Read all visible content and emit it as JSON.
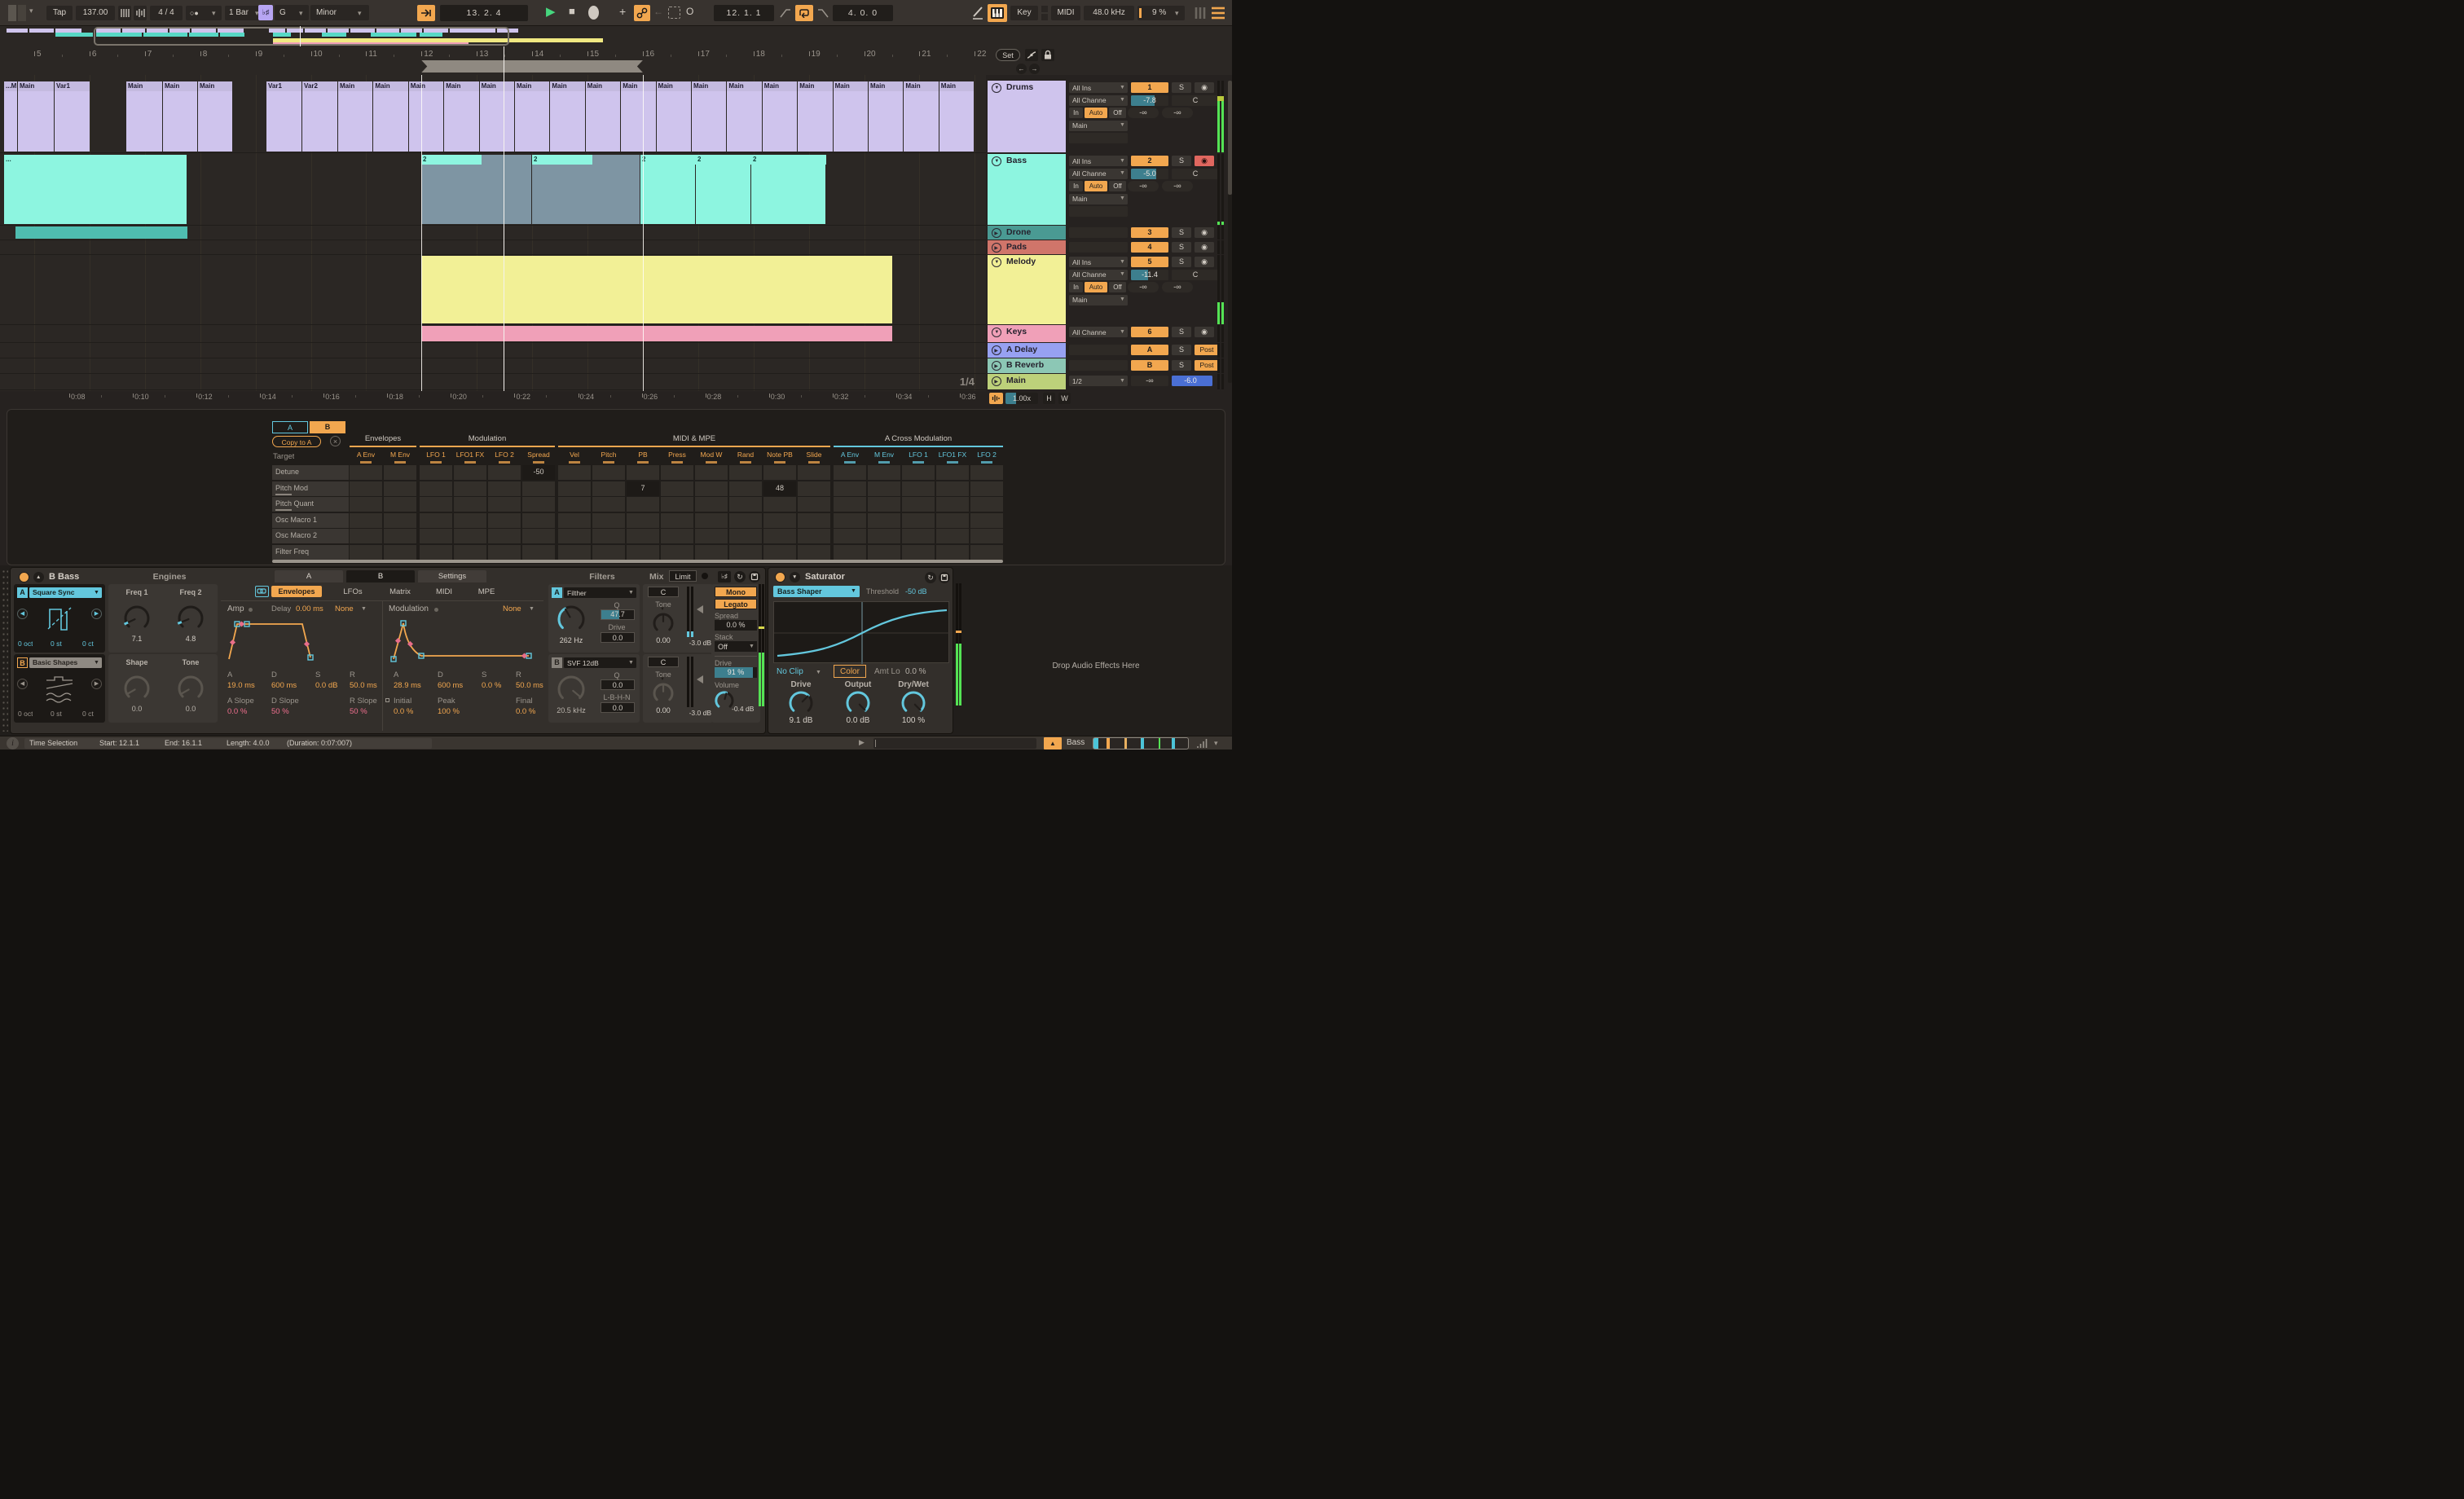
{
  "transport": {
    "tap": "Tap",
    "tempo": "137.00",
    "time_sig": "4 / 4",
    "quantize": "1 Bar",
    "scale_icon": "♭♯",
    "root": "G",
    "mode": "Minor",
    "position": "13.  2.  4",
    "loop_start": "12.  1.  1",
    "loop_length": "4.  0.  0",
    "key": "Key",
    "midi": "MIDI",
    "sample_rate": "48.0 kHz",
    "cpu": "9 %"
  },
  "ruler": {
    "bars": [
      "5",
      "6",
      "7",
      "8",
      "9",
      "10",
      "11",
      "12",
      "13",
      "14",
      "15",
      "16",
      "17",
      "18",
      "19",
      "20",
      "21",
      "22"
    ],
    "set": "Set"
  },
  "time_ruler": [
    "0:08",
    "0:10",
    "0:12",
    "0:14",
    "0:16",
    "0:18",
    "0:20",
    "0:22",
    "0:24",
    "0:26",
    "0:28",
    "0:30",
    "0:32",
    "0:34",
    "0:36"
  ],
  "zoom_bar": {
    "zoom": "1.00x",
    "h": "H",
    "w": "W",
    "ratio": "1/4"
  },
  "tracks": [
    {
      "name": "Drums",
      "number": "1",
      "solo": "S",
      "input": "All Ins",
      "channel": "All Channe",
      "monitor": [
        "In",
        "Auto",
        "Off"
      ],
      "output": "Main",
      "volume": "-7.8",
      "pan": "C",
      "send_a": "-∞",
      "send_b": "-∞"
    },
    {
      "name": "Bass",
      "number": "2",
      "solo": "S",
      "input": "All Ins",
      "channel": "All Channe",
      "monitor": [
        "In",
        "Auto",
        "Off"
      ],
      "output": "Main",
      "volume": "-5.0",
      "pan": "C",
      "send_a": "-∞",
      "send_b": "-∞"
    },
    {
      "name": "Drone",
      "number": "3",
      "solo": "S"
    },
    {
      "name": "Pads",
      "number": "4",
      "solo": "S"
    },
    {
      "name": "Melody",
      "number": "5",
      "solo": "S",
      "input": "All Ins",
      "channel": "All Channe",
      "monitor": [
        "In",
        "Auto",
        "Off"
      ],
      "output": "Main",
      "volume": "-11.4",
      "pan": "C",
      "send_a": "-∞",
      "send_b": "-∞"
    },
    {
      "name": "Keys",
      "number": "6",
      "solo": "S",
      "channel": "All Channe"
    },
    {
      "name": "A Delay",
      "number": "A",
      "solo": "S",
      "post": "Post"
    },
    {
      "name": "B Reverb",
      "number": "B",
      "solo": "S",
      "post": "Post"
    },
    {
      "name": "Main",
      "output": "1/2",
      "volume_left": "-∞",
      "volume_right": "-6.0"
    }
  ],
  "clips": {
    "drums": [
      "...M",
      "Main",
      "Var1",
      "Main",
      "Main",
      "Main",
      "Var1",
      "Var2",
      "Main",
      "Main",
      "Main",
      "Main",
      "Main",
      "Main",
      "Main",
      "Main",
      "Main",
      "Main",
      "Main",
      "Main",
      "Main",
      "Main",
      "Main",
      "Main",
      "Main",
      "Main"
    ],
    "bass": [
      "...",
      "2",
      "2",
      "2",
      "2",
      "2"
    ]
  },
  "matrix": {
    "tab_a": "A",
    "tab_b": "B",
    "copy": "Copy to A",
    "close": "×",
    "target": "Target",
    "groups": [
      "Envelopes",
      "Modulation",
      "MIDI & MPE",
      "A Cross Modulation"
    ],
    "columns": [
      "A Env",
      "M Env",
      "LFO 1",
      "LFO1 FX",
      "LFO 2",
      "Spread",
      "Vel",
      "Pitch",
      "PB",
      "Press",
      "Mod W",
      "Rand",
      "Note PB",
      "Slide",
      "A Env",
      "M Env",
      "LFO 1",
      "LFO1 FX",
      "LFO 2"
    ],
    "rows": [
      "Detune",
      "Pitch Mod",
      "Pitch Quant",
      "Osc Macro 1",
      "Osc Macro 2",
      "Filter Freq"
    ],
    "values": [
      {
        "row": 0,
        "col": 5,
        "v": "-50"
      },
      {
        "row": 1,
        "col": 8,
        "v": "7"
      },
      {
        "row": 1,
        "col": 12,
        "v": "48"
      }
    ]
  },
  "meld": {
    "title": "B Bass",
    "section": "Engines",
    "engine_a": {
      "label": "A",
      "name": "Square Sync",
      "oct": "0 oct",
      "st": "0 st",
      "ct": "0 ct"
    },
    "engine_b": {
      "label": "B",
      "name": "Basic Shapes",
      "oct": "0 oct",
      "st": "0 st",
      "ct": "0 ct"
    },
    "knob_freq1": {
      "label": "Freq 1",
      "value": "7.1"
    },
    "knob_freq2": {
      "label": "Freq 2",
      "value": "4.8"
    },
    "knob_shape": {
      "label": "Shape",
      "value": "0.0"
    },
    "knob_tone": {
      "label": "Tone",
      "value": "0.0"
    },
    "tabs": [
      "A",
      "B",
      "Settings"
    ],
    "subtabs": [
      "Envelopes",
      "LFOs",
      "Matrix",
      "MIDI",
      "MPE"
    ],
    "amp": {
      "title": "Amp",
      "delay_label": "Delay",
      "delay": "0.00 ms",
      "mode": "None",
      "adsr_labels": [
        "A",
        "D",
        "S",
        "R"
      ],
      "adsr_values": [
        "19.0 ms",
        "600 ms",
        "0.0 dB",
        "50.0 ms"
      ],
      "slope_labels": [
        "A Slope",
        "D Slope",
        "R Slope"
      ],
      "slope_values": [
        "0.0 %",
        "50 %",
        "50 %"
      ]
    },
    "mod": {
      "title": "Modulation",
      "mode": "None",
      "adsr_labels": [
        "A",
        "D",
        "S",
        "R"
      ],
      "adsr_values": [
        "28.9 ms",
        "600 ms",
        "0.0 %",
        "50.0 ms"
      ],
      "extra_labels": [
        "Initial",
        "Peak",
        "Final"
      ],
      "extra_values": [
        "0.0 %",
        "100 %",
        "0.0 %"
      ]
    },
    "filters": {
      "header": "Filters",
      "mix": "Mix",
      "limit": "Limit",
      "a": {
        "label": "A",
        "type": "Filther",
        "freq": "262 Hz",
        "q_label": "Q",
        "q": "47.7",
        "drive_label": "Drive",
        "drive": "0.0"
      },
      "b": {
        "label": "B",
        "type": "SVF 12dB",
        "freq": "20.5 kHz",
        "q_label": "Q",
        "q": "0.0",
        "mode_label": "L-B-H-N",
        "mode": "0.0"
      },
      "mix_a": {
        "c": "C",
        "tone": "Tone",
        "value": "0.00",
        "db": "-3.0 dB"
      },
      "mix_b": {
        "c": "C",
        "tone": "Tone",
        "value": "0.00",
        "db": "-3.0 dB"
      }
    },
    "voice": {
      "scale_icon": "♭♯",
      "mono": "Mono",
      "legato": "Legato",
      "spread_label": "Spread",
      "spread": "0.0 %",
      "stack_label": "Stack",
      "stack": "Off",
      "drive_label": "Drive",
      "drive": "91 %",
      "volume_label": "Volume",
      "volume": "-0.4 dB"
    }
  },
  "saturator": {
    "title": "Saturator",
    "curve": "Bass Shaper",
    "threshold_label": "Threshold",
    "threshold": "-50 dB",
    "clip_mode": "No Clip",
    "color": "Color",
    "amt_label": "Amt Lo",
    "amt": "0.0 %",
    "knob_drive": {
      "label": "Drive",
      "value": "9.1 dB"
    },
    "knob_output": {
      "label": "Output",
      "value": "0.0 dB"
    },
    "knob_drywet": {
      "label": "Dry/Wet",
      "value": "100 %"
    }
  },
  "drop_zone": "Drop Audio Effects Here",
  "status": {
    "info": "i",
    "label": "Time Selection",
    "start": "Start: 12.1.1",
    "end": "End: 16.1.1",
    "length": "Length: 4.0.0",
    "duration": "(Duration: 0:07:007)"
  },
  "footer_right": {
    "track": "Bass"
  },
  "icons": {
    "caret": "▾",
    "play": "▶",
    "stop": "■",
    "plus": "+",
    "capture": "O",
    "back": "←",
    "fold_up": "▲",
    "fold_down": "▼",
    "tri_right": "▶",
    "tri_down": "▼",
    "arm": "◉",
    "close": "×",
    "redo": "↻"
  },
  "colors": {
    "orange": "#f2a74f",
    "cyan": "#63c7dd",
    "green": "#46d67e",
    "teal_value": "#3d7f8e",
    "blue_value": "#4a6fd4",
    "purple_chip": "#b7a5f3",
    "drums": "#cfc4ed",
    "bass": "#8df5e0",
    "drone": "#4a9a93",
    "pads": "#d0756a",
    "melody": "#f2f096",
    "keys": "#f0a0b8",
    "a_delay": "#97a1f2",
    "b_reverb": "#8cc7b5",
    "main": "#bdd17a"
  }
}
